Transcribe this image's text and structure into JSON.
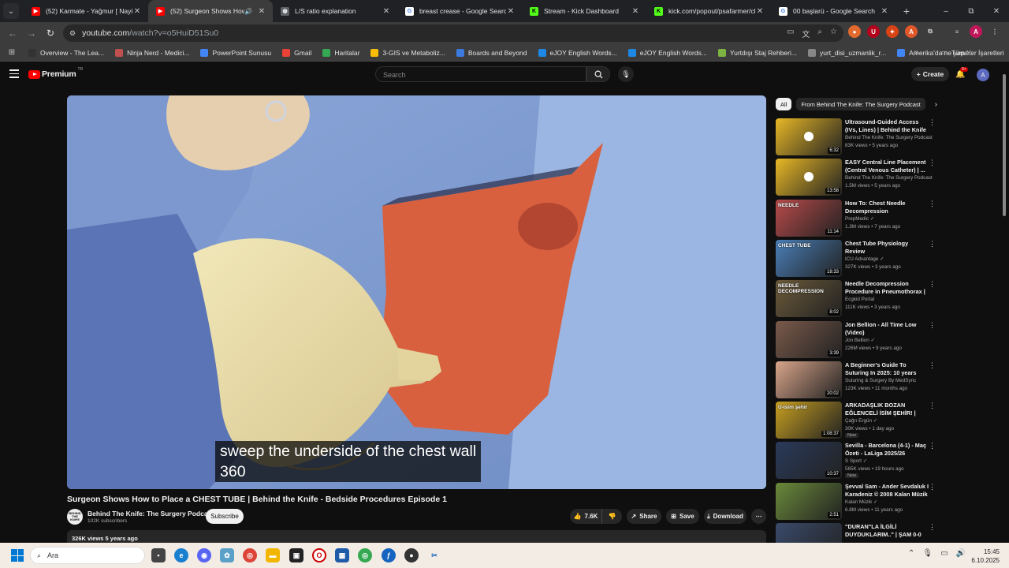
{
  "browser": {
    "tabs": [
      {
        "title": "(52) Karmate - Yağmur [ Nayino",
        "favicon": "youtube",
        "active": false
      },
      {
        "title": "(52) Surgeon Shows How to",
        "favicon": "youtube",
        "active": true,
        "audio": true
      },
      {
        "title": "L/S ratio explanation",
        "favicon": "globe",
        "active": false
      },
      {
        "title": "breast crease - Google Search",
        "favicon": "google",
        "active": false
      },
      {
        "title": "Stream - Kick Dashboard",
        "favicon": "kick",
        "active": false
      },
      {
        "title": "kick.com/popout/psafarmer/ch",
        "favicon": "kick",
        "active": false
      },
      {
        "title": "00 başlarü - Google Search",
        "favicon": "google",
        "active": false
      }
    ],
    "url_host": "youtube.com",
    "url_path": "/watch?v=o5HuiD51Su0",
    "bookmarks": [
      "Overview - The Lea...",
      "Ninja Nerd - Medici...",
      "PowerPoint Sunusu",
      "Gmail",
      "Haritalar",
      "3-GIS ve Metaboliz...",
      "Boards and Beyond",
      "eJOY English Words...",
      "eJOY English Words...",
      "Yurtdışı Staj Rehberi...",
      "yurt_disi_uzmanlik_r...",
      "Amerika'da ne yapa..."
    ],
    "bookmarks_more": "»",
    "all_bookmarks": "Tüm Yer İşaretleri",
    "profile_initial": "A"
  },
  "youtube": {
    "logo_text": "Premium",
    "logo_region": "TR",
    "search_placeholder": "Search",
    "create_label": "Create",
    "notif_badge": "9+",
    "avatar_initial": "A"
  },
  "video": {
    "caption_line1": "sweep the underside of the chest wall",
    "caption_line2": "360",
    "title": "Surgeon Shows How to Place a CHEST TUBE | Behind the Knife - Bedside Procedures Episode 1",
    "channel": "Behind The Knife: The Surgery Podca...",
    "channel_avatar_text": "BEHIND THE KNIFE",
    "subscribers": "102K subscribers",
    "subscribe_label": "Subscribe",
    "likes": "7.6K",
    "share_label": "Share",
    "save_label": "Save",
    "download_label": "Download",
    "views_line": "326K views  5 years ago"
  },
  "chips": {
    "all": "All",
    "from_channel": "From Behind The Knife: The Surgery Podcast"
  },
  "recommendations": [
    {
      "title": "Ultrasound-Guided Access (IVs, Lines) | Behind the Knife - ...",
      "channel": "Behind The Knife: The Surgery Podcast",
      "meta": "83K views • 5 years ago",
      "duration": "6:32",
      "thumb_color": "#e8b826",
      "verified": false,
      "is_new": false
    },
    {
      "title": "EASY Central Line Placement (Central Venous Catheter) | ...",
      "channel": "Behind The Knife: The Surgery Podcast",
      "meta": "1.5M views • 5 years ago",
      "duration": "13:58",
      "thumb_color": "#e8b826",
      "verified": false,
      "is_new": false
    },
    {
      "title": "How To: Chest Needle Decompression",
      "channel": "PrepMedic",
      "meta": "1.3M views • 7 years ago",
      "duration": "11:14",
      "thumb_color": "#b94a4a",
      "verified": true,
      "is_new": false,
      "thumb_text": "NEEDLE"
    },
    {
      "title": "Chest Tube Physiology Review",
      "channel": "ICU Advantage",
      "meta": "327K views • 3 years ago",
      "duration": "18:33",
      "thumb_color": "#4a7fb8",
      "verified": true,
      "is_new": false,
      "thumb_text": "CHEST TUBE"
    },
    {
      "title": "Needle Decompression Procedure in Pneumothorax | ...",
      "channel": "Ecgkid Portal",
      "meta": "111K views • 3 years ago",
      "duration": "8:02",
      "thumb_color": "#6b5a3a",
      "verified": false,
      "is_new": false,
      "thumb_text": "NEEDLE DECOMPRESSION"
    },
    {
      "title": "Jon Bellion - All Time Low (Video)",
      "channel": "Jon Bellion",
      "meta": "226M views • 9 years ago",
      "duration": "3:39",
      "thumb_color": "#7a5a4a",
      "verified": true,
      "is_new": false
    },
    {
      "title": "A Beginner's Guide To Suturing In 2025: 10 years experience i...",
      "channel": "Suturing & Surgery By MedSync",
      "meta": "123K views • 11 months ago",
      "duration": "20:02",
      "thumb_color": "#d9a58a",
      "verified": false,
      "is_new": false
    },
    {
      "title": "ARKADAŞLIK BOZAN EĞLENCELİ İSİM ŞEHİR! | İsim ...",
      "channel": "Çağrı Ergün",
      "meta": "30K views • 1 day ago",
      "duration": "1:08:37",
      "thumb_color": "#c8a020",
      "verified": true,
      "is_new": true,
      "thumb_text": "U-isim şehir"
    },
    {
      "title": "Sevilla - Barcelona (4-1) - Maç Özeti - LaLiga 2025/26",
      "channel": "S Sport",
      "meta": "565K views • 19 hours ago",
      "duration": "10:37",
      "thumb_color": "#2a3a5a",
      "verified": true,
      "is_new": true
    },
    {
      "title": "Şevval Sam - Ander Sevdaluk I Karadeniz © 2008 Kalan Müzik",
      "channel": "Kalan Müzik",
      "meta": "6.8M views • 11 years ago",
      "duration": "2:51",
      "thumb_color": "#6a8a3a",
      "verified": true,
      "is_new": false
    },
    {
      "title": "\"DURAN\"LA İLGİLİ DUYDUKLARIM..\" | ŞAM 0-0 F...",
      "channel": "",
      "meta": "",
      "duration": "",
      "thumb_color": "#3a4a6a",
      "verified": false,
      "is_new": false
    }
  ],
  "taskbar": {
    "search_placeholder": "Ara",
    "time": "15:45",
    "date": "6.10.2025"
  }
}
